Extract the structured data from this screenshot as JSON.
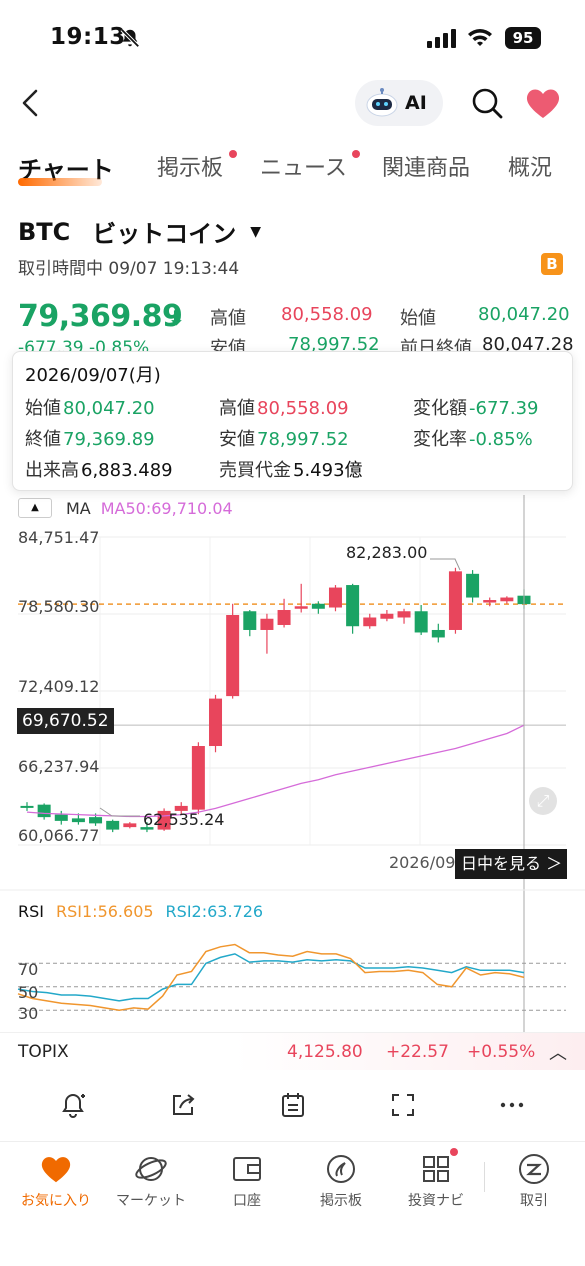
{
  "status_bar": {
    "time": "19:13",
    "battery": "95"
  },
  "header": {
    "ai_label": "AI"
  },
  "tabs": [
    {
      "label": "チャート",
      "active": true,
      "dot": false
    },
    {
      "label": "掲示板",
      "active": false,
      "dot": true
    },
    {
      "label": "ニュース",
      "active": false,
      "dot": true
    },
    {
      "label": "関連商品",
      "active": false,
      "dot": false
    },
    {
      "label": "概況",
      "active": false,
      "dot": false
    }
  ],
  "instrument": {
    "ticker": "BTC",
    "name": "ビットコイン",
    "status": "取引時間中 09/07 19:13:44",
    "badge": "B",
    "price": "79,369.89",
    "change": "-677.39 -0.85%",
    "high_label": "高値",
    "high": "80,558.09",
    "open_label": "始値",
    "open": "80,047.20",
    "low_label": "安値",
    "low": "78,997.52",
    "prev_close_label": "前日終値",
    "prev_close": "80,047.28"
  },
  "tooltip": {
    "date": "2026/09/07(月)",
    "open_label": "始値",
    "open": "80,047.20",
    "high_label": "高値",
    "high": "80,558.09",
    "change_label": "変化額",
    "change": "-677.39",
    "close_label": "終値",
    "close": "79,369.89",
    "low_label": "安値",
    "low": "78,997.52",
    "change_rate_label": "変化率",
    "change_rate": "-0.85%",
    "volume_label": "出来高",
    "volume": "6,883.489",
    "turnover_label": "売買代金",
    "turnover": "5.493億"
  },
  "chart": {
    "ma_label": "MA",
    "ma50_label": "MA50:69,710.04",
    "y_ticks": [
      "84,751.47",
      "78,580.30",
      "72,409.12",
      "66,237.94",
      "60,066.77"
    ],
    "current_price_tag": "69,670.52",
    "max_label": "82,283.00",
    "min_label": "62,535.24",
    "date_label": "2026/09",
    "intraday_button": "日中を見る ＞",
    "expand_icon": "expand-icon"
  },
  "chart_data": {
    "type": "candlestick",
    "ylim": [
      60066.77,
      84751.47
    ],
    "y_ticks": [
      84751.47,
      78580.3,
      72409.12,
      66237.94,
      60066.77
    ],
    "reference_price": 79369.89,
    "candles": [
      {
        "o": 63200,
        "c": 63100,
        "h": 63500,
        "l": 62800
      },
      {
        "o": 63300,
        "c": 62300,
        "h": 63400,
        "l": 62100
      },
      {
        "o": 62500,
        "c": 62000,
        "h": 62800,
        "l": 61700
      },
      {
        "o": 62200,
        "c": 61900,
        "h": 62600,
        "l": 61700
      },
      {
        "o": 62300,
        "c": 61800,
        "h": 62600,
        "l": 61600
      },
      {
        "o": 62000,
        "c": 61300,
        "h": 62100,
        "l": 61100
      },
      {
        "o": 61500,
        "c": 61800,
        "h": 61900,
        "l": 61400
      },
      {
        "o": 61500,
        "c": 61300,
        "h": 61900,
        "l": 61100
      },
      {
        "o": 61300,
        "c": 62800,
        "h": 63000,
        "l": 61200
      },
      {
        "o": 62800,
        "c": 63200,
        "h": 63500,
        "l": 62500
      },
      {
        "o": 62900,
        "c": 68000,
        "h": 68300,
        "l": 62535.24
      },
      {
        "o": 68000,
        "c": 71800,
        "h": 72100,
        "l": 67500
      },
      {
        "o": 72000,
        "c": 78500,
        "h": 79400,
        "l": 71800
      },
      {
        "o": 78800,
        "c": 77300,
        "h": 78900,
        "l": 76800
      },
      {
        "o": 77300,
        "c": 78200,
        "h": 78600,
        "l": 75400
      },
      {
        "o": 77700,
        "c": 78900,
        "h": 79800,
        "l": 77500
      },
      {
        "o": 79000,
        "c": 79200,
        "h": 81000,
        "l": 78700
      },
      {
        "o": 79400,
        "c": 79000,
        "h": 79600,
        "l": 78600
      },
      {
        "o": 79100,
        "c": 80700,
        "h": 80900,
        "l": 78800
      },
      {
        "o": 80900,
        "c": 77600,
        "h": 81000,
        "l": 77000
      },
      {
        "o": 77600,
        "c": 78300,
        "h": 78600,
        "l": 77400
      },
      {
        "o": 78200,
        "c": 78600,
        "h": 78900,
        "l": 78000
      },
      {
        "o": 78300,
        "c": 78800,
        "h": 79000,
        "l": 77800
      },
      {
        "o": 78800,
        "c": 77100,
        "h": 79300,
        "l": 76900
      },
      {
        "o": 77300,
        "c": 76700,
        "h": 77800,
        "l": 76300
      },
      {
        "o": 77300,
        "c": 82000,
        "h": 82283.0,
        "l": 77000
      },
      {
        "o": 81800,
        "c": 79900,
        "h": 82100,
        "l": 79500
      },
      {
        "o": 79500,
        "c": 79700,
        "h": 79900,
        "l": 79200
      },
      {
        "o": 79600,
        "c": 79900,
        "h": 80000,
        "l": 79400
      },
      {
        "o": 80047.2,
        "c": 79369.89,
        "h": 80558.09,
        "l": 78997.52
      }
    ],
    "ma50": [
      62700,
      62600,
      62550,
      62500,
      62450,
      62400,
      62350,
      62350,
      62400,
      62500,
      62700,
      63000,
      63400,
      63800,
      64200,
      64600,
      65000,
      65300,
      65700,
      66000,
      66300,
      66600,
      66900,
      67200,
      67500,
      67800,
      68200,
      68600,
      69000,
      69670.52
    ],
    "rsi_ylim": [
      20,
      100
    ],
    "rsi_ticks": [
      70,
      50,
      30
    ],
    "rsi1": [
      44,
      40,
      38,
      36,
      35,
      34,
      32,
      30,
      32,
      31,
      42,
      60,
      63,
      80,
      84,
      86,
      79,
      79,
      77,
      76,
      80,
      78,
      78,
      74,
      62,
      63,
      63,
      64,
      62,
      52,
      50,
      66,
      60,
      62,
      61,
      58
    ],
    "rsi2": [
      48,
      46,
      45,
      43,
      43,
      42,
      40,
      38,
      40,
      40,
      48,
      52,
      52,
      70,
      75,
      78,
      71,
      72,
      72,
      71,
      73,
      72,
      73,
      72,
      66,
      66,
      66,
      67,
      66,
      64,
      62,
      67,
      64,
      64,
      64,
      62
    ]
  },
  "rsi": {
    "label": "RSI",
    "rsi1_label": "RSI1:56.605",
    "rsi2_label": "RSI2:63.726",
    "ticks": [
      "70",
      "50",
      "30"
    ]
  },
  "topix": {
    "name": "TOPIX",
    "value": "4,125.80",
    "change": "+22.57",
    "change_pct": "+0.55%"
  },
  "toolbar_icons": [
    "alert-icon",
    "share-icon",
    "calendar-icon",
    "fullscreen-icon",
    "more-icon"
  ],
  "bottom_nav": [
    {
      "label": "お気に入り",
      "icon": "heart-icon",
      "active": true
    },
    {
      "label": "マーケット",
      "icon": "planet-icon",
      "active": false
    },
    {
      "label": "口座",
      "icon": "wallet-icon",
      "active": false
    },
    {
      "label": "掲示板",
      "icon": "board-icon",
      "active": false
    },
    {
      "label": "投資ナビ",
      "icon": "grid-icon",
      "active": false
    },
    {
      "label": "取引",
      "icon": "trade-icon",
      "active": false
    }
  ],
  "colors": {
    "up": "#e8455c",
    "down": "#1aa364",
    "accent": "#f06a00",
    "ma50": "#d56bd9",
    "rsi1": "#f0962e",
    "rsi2": "#23a8c9"
  }
}
